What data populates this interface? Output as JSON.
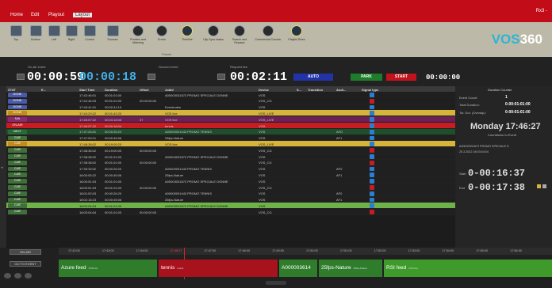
{
  "window": {
    "controls": "Rx3 -"
  },
  "menu": [
    "Home",
    "Edit",
    "Playout",
    "Layout"
  ],
  "ribbon": {
    "buttons": [
      {
        "label": "Top",
        "icon": "layout-top-icon"
      },
      {
        "label": "Bottom",
        "icon": "layout-bottom-icon"
      },
      {
        "label": "Left",
        "icon": "layout-left-icon"
      },
      {
        "label": "Right",
        "icon": "layout-right-icon"
      },
      {
        "label": "Control",
        "icon": "control-icon"
      },
      {
        "label": "Sources",
        "icon": "sources-icon"
      },
      {
        "label": "Preview and Metering",
        "icon": "preview-eye-icon"
      },
      {
        "label": "Errors",
        "icon": "errors-icon"
      },
      {
        "label": "Timeline",
        "icon": "timeline-play-icon"
      },
      {
        "label": "Clip Sync status",
        "icon": "clip-sync-icon"
      },
      {
        "label": "Search and Replace",
        "icon": "search-icon"
      },
      {
        "label": "Commercial Counter",
        "icon": "commercial-icon"
      },
      {
        "label": "Playlist Sizes",
        "icon": "playlist-icon"
      }
    ],
    "group_label": "Panels"
  },
  "logo": {
    "prefix": "VOS",
    "suffix": "360"
  },
  "counters": {
    "on_air_label": "On-Air event",
    "on_air_elapsed": "00:00:59",
    "on_air_remaining": "00:00:18",
    "second_label": "Second event",
    "next_label": "Request live",
    "next_value": "00:02:11",
    "auto_label": "AUTO",
    "park_label": "PARK",
    "start_label": "START",
    "start_value": "00:00:00"
  },
  "table": {
    "headers": [
      "STAT",
      "E...",
      "Start Time",
      "Duration",
      "Offset",
      "Jobld",
      "Device",
      "S...",
      "Transition",
      "Audi...",
      "Signal type"
    ],
    "rows": [
      {
        "stat": "DONE",
        "start": "17:42:46:01",
        "dur": "00:01:01:00",
        "offset": "",
        "job": "A00003031872 PROMO SPECIALE DONNE",
        "device": "VOS",
        "trans": "",
        "audio": "",
        "sig": "blue",
        "style": "done"
      },
      {
        "stat": "DONE",
        "start": "17:42:46:03",
        "dur": "00:01:01:00",
        "offset": "00:00:00:00",
        "job": "",
        "device": "VOS_CG",
        "trans": "",
        "audio": "",
        "sig": "red",
        "style": "done"
      },
      {
        "stat": "DONE",
        "start": "17:43:41:01",
        "dur": "00:02:41:19",
        "offset": "",
        "job": "Eventnotes",
        "device": "VOS",
        "trans": "",
        "audio": "",
        "sig": "blue",
        "style": "done"
      },
      {
        "stat": "DONE",
        "start": "17:44:29:22",
        "dur": "00:01:42:20",
        "offset": "",
        "job": "VOS live",
        "device": "VOS_LIVE",
        "trans": "",
        "audio": "",
        "sig": "blue",
        "style": "yellow"
      },
      {
        "stat": "N/A",
        "start": "17:46:07:22",
        "dur": "00:03:18:06",
        "offset": "37",
        "job": "VOS live",
        "device": "VOS_LIVE",
        "trans": "",
        "audio": "",
        "sig": "blue",
        "style": "na"
      },
      {
        "stat": "ON-AIR",
        "start": "17:46:07:22",
        "dur": "00:00:18:04",
        "offset": "",
        "job": "tennis",
        "device": "VOS",
        "trans": "",
        "audio": "",
        "sig": "blue",
        "style": "onair"
      },
      {
        "stat": "NEXT",
        "start": "17:47:26:01",
        "dur": "00:00:26:20",
        "offset": "",
        "job": "A00000001443 PROMO TENNIS",
        "device": "VOS",
        "trans": "",
        "audio": "AFD",
        "sig": "blue",
        "style": "next"
      },
      {
        "stat": "CUE",
        "start": "17:47:53:21",
        "dur": "00:00:45:06",
        "offset": "",
        "job": "25fps-Nature",
        "device": "VOS",
        "trans": "",
        "audio": "AF1",
        "sig": "blue",
        "style": "cue"
      },
      {
        "stat": "CUE",
        "start": "17:48:38:02",
        "dur": "00:19:09:20",
        "offset": "",
        "job": "VOS live",
        "device": "VOS_LIVE",
        "trans": "",
        "audio": "",
        "sig": "blue",
        "style": "yellow"
      },
      {
        "stat": "CUE",
        "start": "17:48:38:02",
        "dur": "00:19:00:00",
        "offset": "00:00:00:00",
        "job": "",
        "device": "VOS_CG",
        "trans": "",
        "audio": "",
        "sig": "red",
        "style": "cue"
      },
      {
        "stat": "CUE",
        "start": "17:38:38:02",
        "dur": "00:01:01:00",
        "offset": "",
        "job": "A00003031872 PROMO SPECIALE DONNE",
        "device": "VOS",
        "trans": "",
        "audio": "",
        "sig": "blue",
        "style": "cue"
      },
      {
        "stat": "CUE",
        "start": "17:38:38:02",
        "dur": "00:01:01:00",
        "offset": "00:00:00:00",
        "job": "",
        "device": "VOS_CG",
        "trans": "",
        "audio": "",
        "sig": "red",
        "style": "cue"
      },
      {
        "stat": "CUE",
        "start": "17:39:39:02",
        "dur": "00:00:26:20",
        "offset": "",
        "job": "A00000001443 PROMO TENNIS",
        "device": "VOS",
        "trans": "",
        "audio": "AF0",
        "sig": "blue",
        "style": "cue"
      },
      {
        "stat": "CUE",
        "start": "18:00:05:22",
        "dur": "00:00:45:06",
        "offset": "",
        "job": "25fps-Nature",
        "device": "VOS",
        "trans": "",
        "audio": "AF1",
        "sig": "blue",
        "style": "cue"
      },
      {
        "stat": "CUE",
        "start": "18:00:51:03",
        "dur": "00:01:01:00",
        "offset": "",
        "job": "A00003031872 PROMO SPECIALE DONNE",
        "device": "VOS",
        "trans": "",
        "audio": "",
        "sig": "blue",
        "style": "cue"
      },
      {
        "stat": "CUE",
        "start": "18:00:51:03",
        "dur": "00:01:01:00",
        "offset": "00:00:00:00",
        "job": "",
        "device": "VOS_CG",
        "trans": "",
        "audio": "",
        "sig": "red",
        "style": "cue"
      },
      {
        "stat": "CUE",
        "start": "18:01:52:03",
        "dur": "00:00:26:20",
        "offset": "",
        "job": "A00000001443 PROMO TENNIS",
        "device": "VOS",
        "trans": "",
        "audio": "AF0",
        "sig": "blue",
        "style": "cue"
      },
      {
        "stat": "CUE",
        "start": "18:02:18:23",
        "dur": "00:00:45:06",
        "offset": "",
        "job": "25fps-Nature",
        "device": "VOS",
        "trans": "",
        "audio": "AF1",
        "sig": "blue",
        "style": "cue"
      },
      {
        "stat": "CUE",
        "start": "18:03:04:04",
        "dur": "00:01:01:00",
        "offset": "",
        "job": "A00003031872 PROMO SPECIALE DONNE",
        "device": "VOS",
        "trans": "",
        "audio": "",
        "sig": "blue",
        "style": "green"
      },
      {
        "stat": "CUE",
        "start": "18:03:04:04",
        "dur": "00:01:01:00",
        "offset": "00:00:00:00",
        "job": "",
        "device": "VOS_CG",
        "trans": "",
        "audio": "",
        "sig": "red",
        "style": "cue"
      }
    ]
  },
  "right_panel": {
    "title": "Duration Counter",
    "event_count_label": "Event Count:",
    "event_count": "1",
    "total_duration_label": "Total Duration:",
    "total_duration": "0-00:01:01:00",
    "tot_dur_overlap_label": "Tot. Dur. (Overlap):",
    "tot_dur_overlap": "0-00:01:01:00",
    "date": "Monday 17:46:27",
    "countdown_label": "Countdown to Event",
    "event_name": "A00003031872 PROMO SPECIALE D",
    "event_date": "25.3.2022 18:03:04:04",
    "start_label": "Start",
    "start_value": "0-00:16:37",
    "end_label": "End",
    "end_value": "0-00:17:38"
  },
  "timeline": {
    "on_air_btn": "ON-AIR",
    "go_to_event_btn": "GO TO EVENT",
    "ticks": [
      "17:42:00",
      "17:43:00",
      "17:44:00",
      "17:46:27",
      "17:47:00",
      "17:48:00",
      "17:49:00",
      "17:50:00",
      "17:51:00",
      "17:52:00",
      "17:53:00",
      "17:54:00",
      "17:55:00",
      "17:56:00"
    ],
    "blocks": [
      {
        "label": "Azure feed",
        "sub": "VOS live",
        "color": "#2f7d2b"
      },
      {
        "label": "tennis",
        "sub": "tennis",
        "color": "#a8121c"
      },
      {
        "label": "A000003614",
        "sub": "",
        "color": "#2f7d2b"
      },
      {
        "label": "25fps-Nature",
        "sub": "25fps-Nature",
        "color": "#2f7d2b"
      },
      {
        "label": "RSI feed",
        "sub": "VOS live",
        "color": "#3f9a2c"
      }
    ]
  }
}
